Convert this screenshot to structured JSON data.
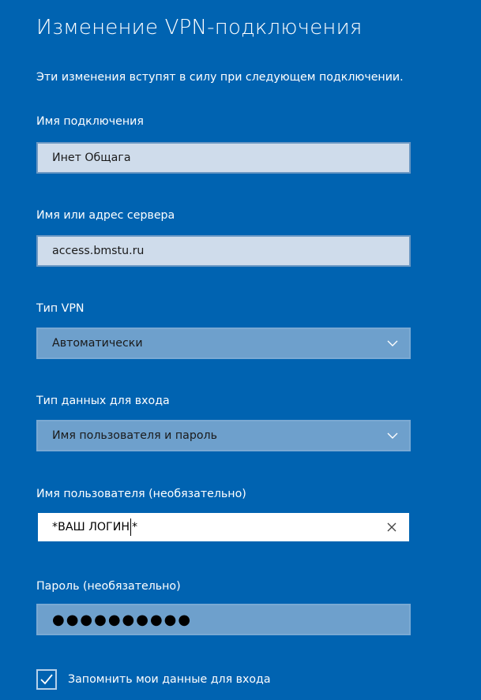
{
  "dialog": {
    "title": "Изменение VPN-подключения",
    "note": "Эти изменения вступят в силу при следующем подключении."
  },
  "fields": {
    "connection_name": {
      "label": "Имя подключения",
      "value": "Инет Общага"
    },
    "server": {
      "label": "Имя или адрес сервера",
      "value": "access.bmstu.ru"
    },
    "vpn_type": {
      "label": "Тип VPN",
      "value": "Автоматически"
    },
    "signin_type": {
      "label": "Тип данных для входа",
      "value": "Имя пользователя и пароль"
    },
    "username": {
      "label": "Имя пользователя (необязательно)",
      "value_before_caret": "*ВАШ ЛОГИН",
      "value_after_caret": "*"
    },
    "password": {
      "label": "Пароль (необязательно)",
      "value": "●●●●●●●●●●"
    }
  },
  "remember": {
    "label": "Запомнить мои данные для входа",
    "checked": true
  },
  "icons": {
    "dropdown": "chevron-down-icon",
    "clear": "clear-icon",
    "check": "checkmark-icon"
  },
  "colors": {
    "background": "#0063B1",
    "text": "#FFFFFF"
  }
}
